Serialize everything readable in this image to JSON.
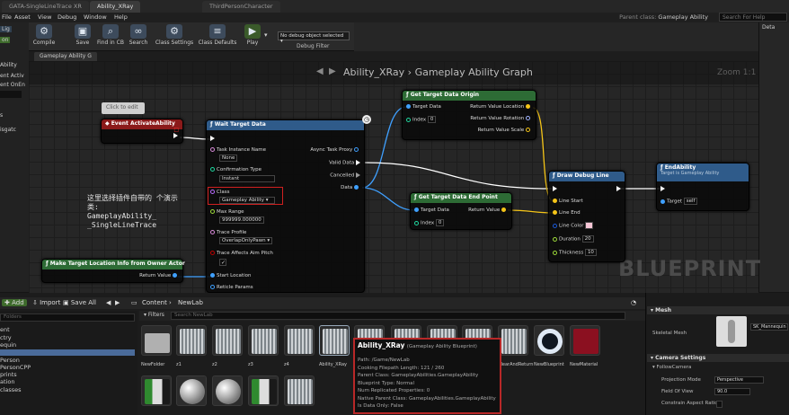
{
  "tabs": [
    "GATA-SingleLineTrace XR",
    "Ability_XRay",
    "ThirdPersonCharacter"
  ],
  "menu": [
    "File",
    "Asset",
    "View",
    "Debug",
    "Window",
    "Help"
  ],
  "parent_class": {
    "label": "Parent class:",
    "value": "Gameplay Ability"
  },
  "help_search": "Search For Help",
  "left_panel": [
    "Lig",
    "on",
    "Ability",
    "ent Activ",
    "ent OnEn",
    "",
    "s",
    "",
    "isgatc"
  ],
  "toolbar": {
    "buttons": [
      {
        "label": "Compile",
        "icon": "gear-check-icon"
      },
      {
        "label": "Save",
        "icon": "disk-icon"
      },
      {
        "label": "Find in CB",
        "icon": "magnifier-icon"
      },
      {
        "label": "Search",
        "icon": "binoculars-icon"
      },
      {
        "label": "Class Settings",
        "icon": "settings-icon"
      },
      {
        "label": "Class Defaults",
        "icon": "defaults-icon"
      },
      {
        "label": "Play",
        "icon": "play-icon"
      }
    ],
    "debug_select": "No debug object selected ▾",
    "debug_filter": "Debug Filter"
  },
  "details_strip": "Deta",
  "graph": {
    "tab": "Gameplay Ability G",
    "title": "Ability_XRay › Gameplay Ability Graph",
    "zoom": "Zoom 1:1",
    "watermark": "BLUEPRINT",
    "comment_bubble": "Click to edit",
    "annotation_lines": [
      "这里选择插件自带的 个演示",
      "类:",
      "GameplayAbility_",
      "_SingleLineTrace"
    ]
  },
  "nodes": {
    "event_activate": {
      "title": "Event ActivateAbility"
    },
    "wait_target": {
      "title": "Wait Target Data",
      "task_instance_name": "Task Instance Name",
      "task_instance_value": "None",
      "confirmation_type": "Confirmation Type",
      "confirmation_value": "Instant",
      "class_label": "Class",
      "class_value": "Gameplay Ability ▾",
      "max_range": "Max Range",
      "max_range_value": "999999.000000",
      "trace_profile": "Trace Profile",
      "trace_profile_value": "OverlapOnlyPawn ▾",
      "trace_affects": "Trace Affects Aim Pitch",
      "start_location": "Start Location",
      "reticle_params": "Reticle Params",
      "async_proxy": "Async Task Proxy",
      "valid_data": "Valid Data",
      "cancelled": "Cancelled",
      "data": "Data"
    },
    "get_origin": {
      "title": "Get Target Data Origin",
      "target_data": "Target Data",
      "index": "Index",
      "index_value": "0",
      "return_location": "Return Value Location",
      "return_rotation": "Return Value Rotation",
      "return_scale": "Return Value Scale"
    },
    "get_end": {
      "title": "Get Target Data End Point",
      "target_data": "Target Data",
      "index": "Index",
      "index_value": "0",
      "return_value": "Return Value"
    },
    "draw_debug": {
      "title": "Draw Debug Line",
      "line_start": "Line Start",
      "line_end": "Line End",
      "line_color": "Line Color",
      "duration": "Duration",
      "duration_value": "20",
      "thickness": "Thickness",
      "thickness_value": "10"
    },
    "end_ability": {
      "title": "EndAbility",
      "subtitle": "Target is Gameplay Ability",
      "target": "Target",
      "target_value": "self"
    },
    "make_target": {
      "title": "Make Target Location Info from Owner Actor",
      "return_value": "Return Value"
    }
  },
  "content_browser": {
    "add_label": "Add",
    "import_label": "Import",
    "save_all_label": "Save All",
    "path": [
      "Content",
      "NewLab"
    ],
    "filters_label": "Filters",
    "search_placeholder": "Search NewLab",
    "sources_search": "Folders",
    "sources": [
      "ent",
      "ctry",
      "equin",
      "",
      "Person",
      "PersonCPP",
      "prints",
      "ation",
      "classes"
    ],
    "assets": [
      {
        "name": "NewFolder",
        "kind": "folder"
      },
      {
        "name": "z1",
        "kind": "grid"
      },
      {
        "name": "z2",
        "kind": "grid"
      },
      {
        "name": "z3",
        "kind": "grid"
      },
      {
        "name": "z4",
        "kind": "grid"
      },
      {
        "name": "Ability_XRay",
        "kind": "grid-selected"
      },
      {
        "name": "",
        "kind": "grid"
      },
      {
        "name": "",
        "kind": "grid"
      },
      {
        "name": "",
        "kind": "grid"
      },
      {
        "name": "BlockingVolume",
        "kind": "grid"
      },
      {
        "name": "ClearAndReturn",
        "kind": "grid"
      },
      {
        "name": "NewBlueprint",
        "kind": "ring"
      },
      {
        "name": "NewMaterial",
        "kind": "red"
      },
      {
        "name": "",
        "kind": "green"
      },
      {
        "name": "",
        "kind": "sphere"
      },
      {
        "name": "",
        "kind": "sphere"
      },
      {
        "name": "",
        "kind": "green"
      },
      {
        "name": "",
        "kind": "grid"
      }
    ]
  },
  "tooltip": {
    "title": "Ability_XRay",
    "subtitle": "(Gameplay Ability Blueprint)",
    "lines": [
      "Path: /Game/NewLab",
      "Cooking Filepath Length: 121 / 260",
      "Parent Class: GameplayAbilities.GameplayAbility",
      "Blueprint Type: Normal",
      "Num Replicated Properties: 0",
      "Native Parent Class: GameplayAbilities.GameplayAbility",
      "Is Data Only: False"
    ]
  },
  "details": {
    "mesh_section": "Mesh",
    "skeletal_mesh": "Skeletal Mesh",
    "mannequin": "SK_Mannequin",
    "camera_section": "Camera Settings",
    "follow_camera": "FollowCamera",
    "projection_mode": "Projection Mode",
    "projection_value": "Perspective",
    "fov": "Field Of View",
    "fov_value": "90.0",
    "constrain": "Constrain Aspect Ratio"
  },
  "colors": {
    "exec": "#ffffff",
    "struct": "#3fa0ff",
    "vector": "#f5c518",
    "int": "#1fd9a0",
    "red_header": "#8b1a1a",
    "blue_header": "#2f5b8a",
    "green_header": "#2d6b35"
  }
}
